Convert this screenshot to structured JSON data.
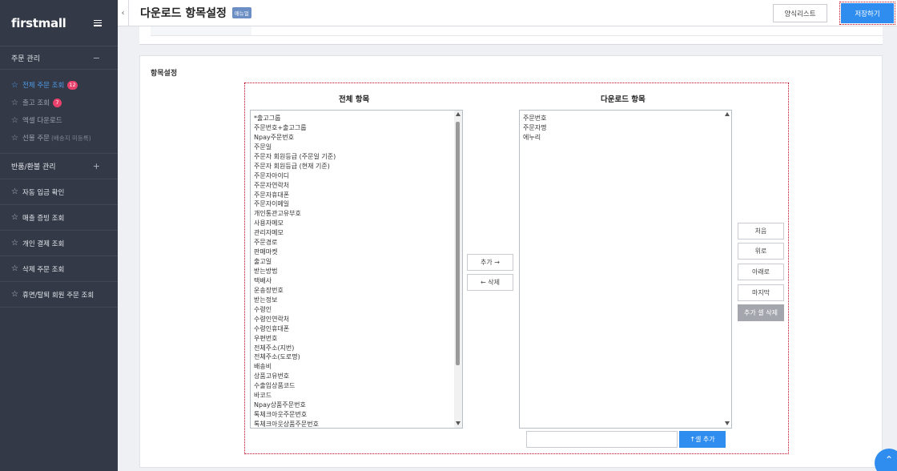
{
  "sidebar": {
    "logo": "firstmall",
    "section_order": {
      "label": "주문 관리",
      "toggle": "−"
    },
    "order_items": [
      {
        "label": "전체 주문 조회",
        "badge": "12"
      },
      {
        "label": "출고 조회",
        "badge": "7"
      },
      {
        "label": "엑셀 다운로드",
        "badge": ""
      },
      {
        "label": "선물 주문",
        "note": "(배송지 미등록)"
      }
    ],
    "section_refund": {
      "label": "반품/환불 관리",
      "toggle": "+"
    },
    "menu_rows": [
      {
        "label": "자동 입금 확인"
      },
      {
        "label": "매출 증빙 조회"
      },
      {
        "label": "개인 결제 조회"
      },
      {
        "label": "삭제 주문 조회"
      },
      {
        "label": "휴면/탈퇴 회원 주문 조회"
      }
    ]
  },
  "header": {
    "title": "다운로드 항목설정",
    "manual_tag": "매뉴얼",
    "form_list_label": "양식리스트",
    "save_label": "저장하기"
  },
  "section": {
    "title": "항목설정"
  },
  "all_items": {
    "title": "전체 항목",
    "items": [
      "*출고그룹",
      "주문번호+출고그룹",
      "Npay주문번호",
      "주문일",
      "주문자 회원등급 (주문일 기준)",
      "주문자 회원등급 (현재 기준)",
      "주문자아이디",
      "주문자연락처",
      "주문자휴대폰",
      "주문자이메일",
      "개인통관고유부호",
      "사용자메모",
      "관리자메모",
      "주문경로",
      "판매마켓",
      "출고일",
      "받는방법",
      "택배사",
      "운송장번호",
      "받는정보",
      "수령인",
      "수령인연락처",
      "수령인휴대폰",
      "우편번호",
      "전체주소(지번)",
      "전체주소(도로명)",
      "배송비",
      "상품고유번호",
      "수출입상품코드",
      "바코드",
      "Npay상품주문번호",
      "톡체크아웃주문번호",
      "톡체크아웃상품주문번호"
    ]
  },
  "download_items": {
    "title": "다운로드 항목",
    "items": [
      "주문번호",
      "주문자명",
      "에누리"
    ]
  },
  "transfer": {
    "add_label": "추가 →",
    "remove_label": "← 삭제"
  },
  "order_controls": {
    "first": "처음",
    "up": "위로",
    "down": "아래로",
    "last": "마지막",
    "delete_added": "추가 셀 삭제"
  },
  "cell_add": {
    "input_value": "",
    "button_label": "↑셀 추가"
  },
  "colors": {
    "accent": "#2f8def",
    "sidebar_bg": "#333947",
    "highlight": "#c0001a"
  }
}
